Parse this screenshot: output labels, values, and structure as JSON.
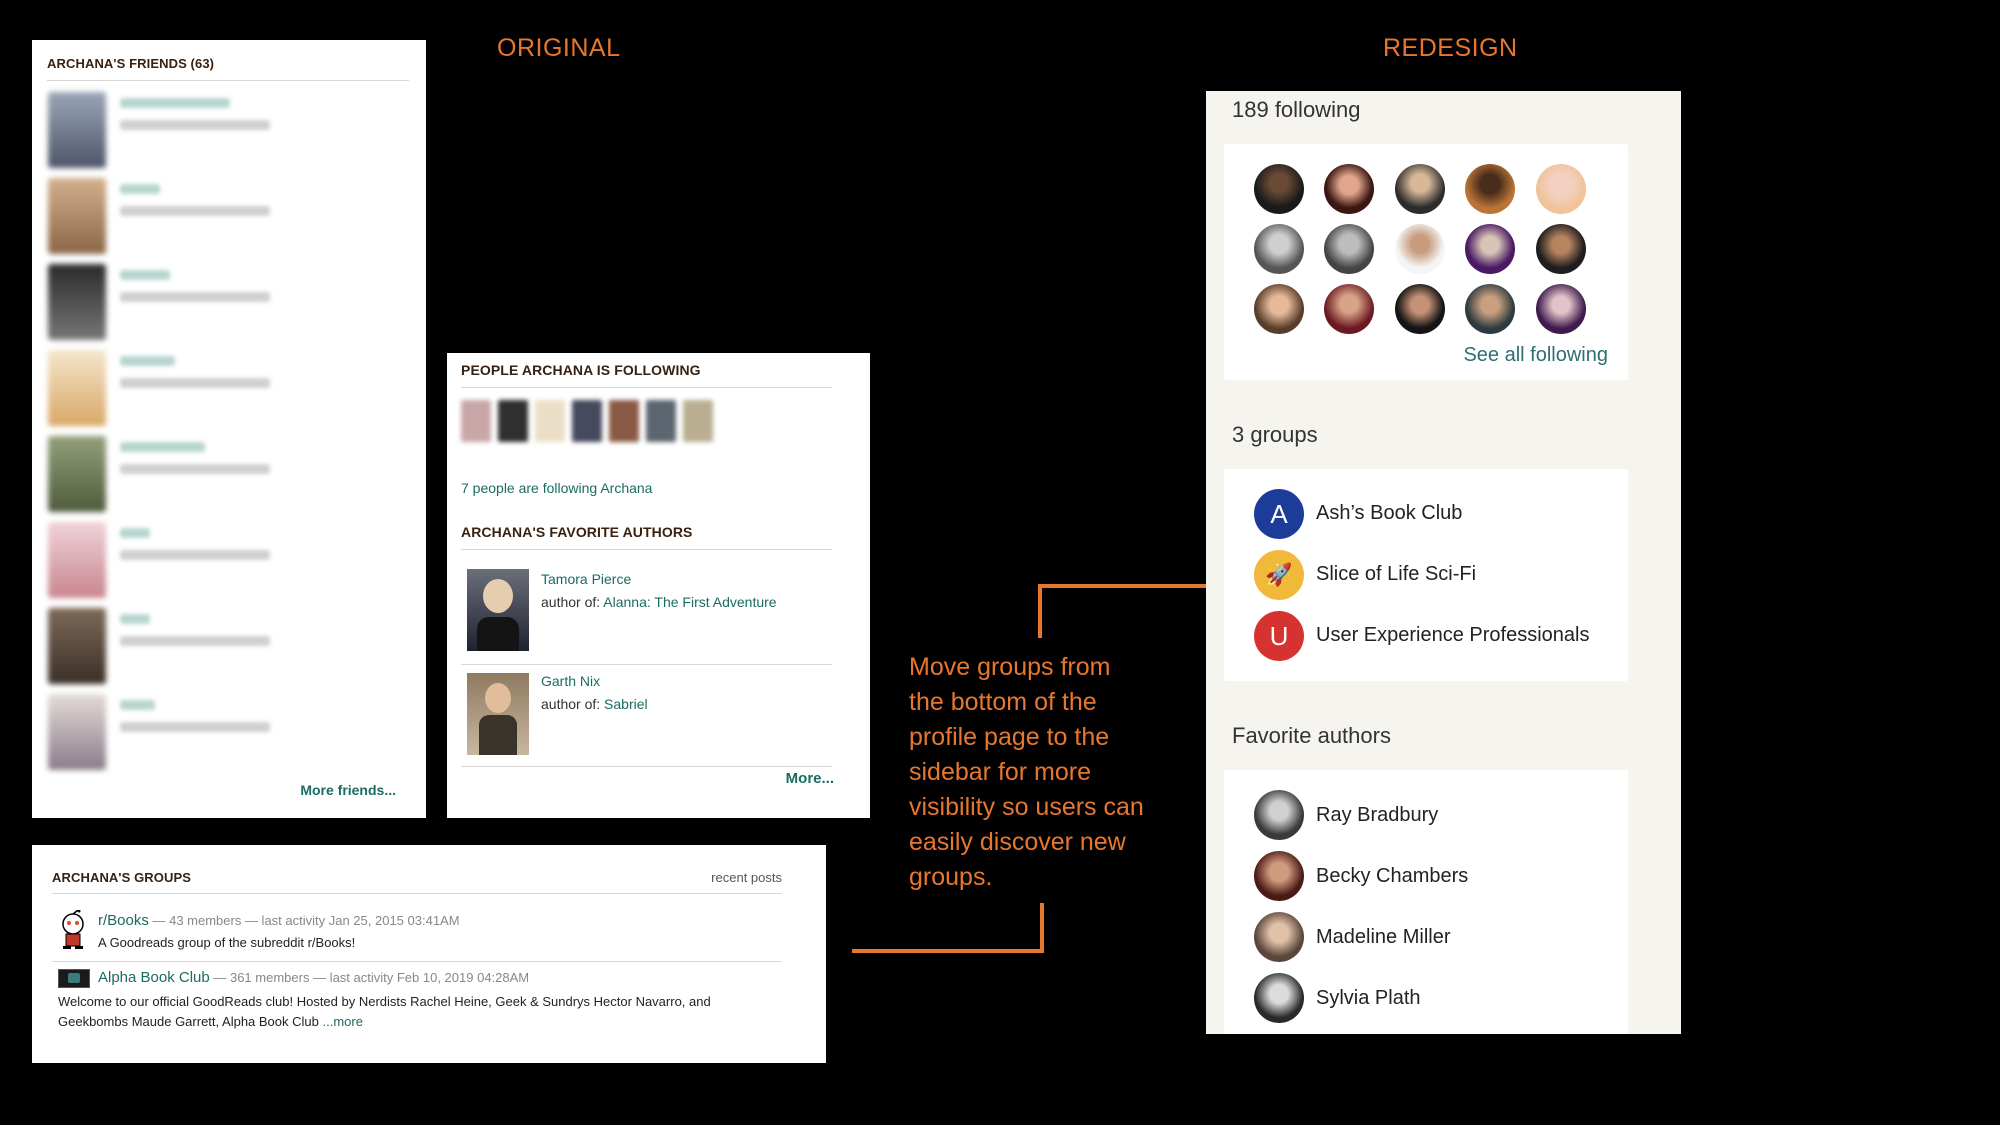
{
  "labels": {
    "original": "ORIGINAL",
    "redesign": "REDESIGN"
  },
  "friends": {
    "title": "ARCHANA'S FRIENDS (63)",
    "more": "More friends..."
  },
  "following_panel": {
    "title": "PEOPLE ARCHANA IS FOLLOWING",
    "followers_link": "7 people are following Archana",
    "authors_title": "ARCHANA'S FAVORITE AUTHORS",
    "authors": [
      {
        "name": "Tamora Pierce",
        "prefix": "author of:",
        "book": "Alanna: The First Adventure"
      },
      {
        "name": "Garth Nix",
        "prefix": "author of:",
        "book": "Sabriel"
      }
    ],
    "more": "More..."
  },
  "groups_panel": {
    "title": "ARCHANA'S GROUPS",
    "recent": "recent posts",
    "groups": [
      {
        "name": "r/Books",
        "meta": " — 43 members — last activity Jan 25, 2015 03:41AM",
        "desc": "A Goodreads group of the subreddit r/Books!"
      },
      {
        "name": "Alpha Book Club",
        "meta": " — 361 members — last activity Feb 10, 2019 04:28AM",
        "desc1": "Welcome to our official GoodReads club! Hosted by Nerdists Rachel Heine, Geek & Sundrys Hector Navarro, and",
        "desc2": "Geekbombs Maude Garrett, Alpha Book Club ",
        "more": "...more"
      }
    ]
  },
  "annotation": {
    "lines": [
      "Move groups from",
      "the bottom of the",
      "profile page to the",
      "sidebar for more",
      "visibility so users can",
      "easily discover new",
      "groups."
    ]
  },
  "redesign": {
    "following_header": "189 following",
    "see_all": "See all following",
    "groups_header": "3 groups",
    "groups": [
      {
        "initial": "A",
        "name": "Ash’s Book Club",
        "color": "#1d3c9a"
      },
      {
        "initial": "🚀",
        "name": "Slice of Life Sci-Fi",
        "color": "#f0b93a"
      },
      {
        "initial": "U",
        "name": "User Experience Professionals",
        "color": "#d6322f"
      }
    ],
    "authors_header": "Favorite authors",
    "authors": [
      "Ray Bradbury",
      "Becky Chambers",
      "Madeline Miller",
      "Sylvia Plath"
    ]
  },
  "colors": {
    "accent": "#e8772e",
    "link": "#1b6b63",
    "panel_bg": "#f6f4ef"
  }
}
